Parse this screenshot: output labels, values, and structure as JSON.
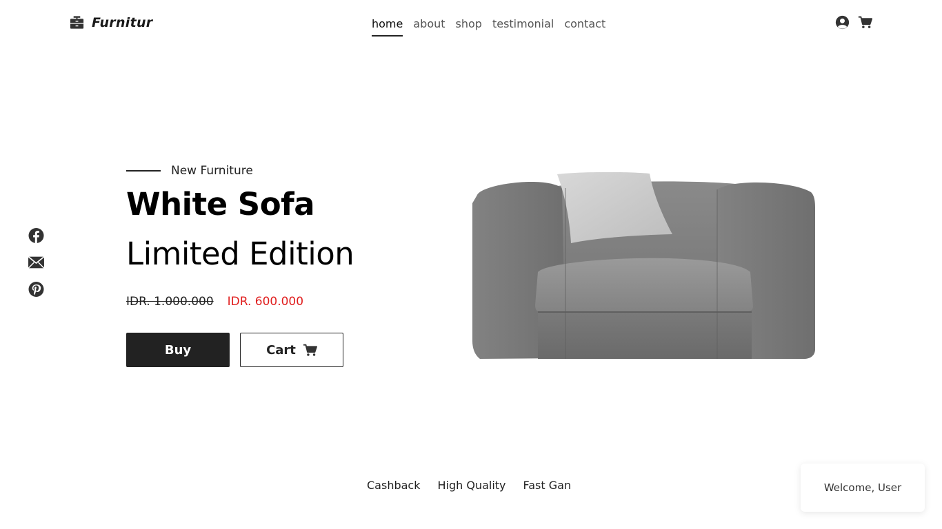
{
  "brand": {
    "name": "Furnitur",
    "icon": "dresser-icon"
  },
  "nav": {
    "items": [
      {
        "label": "home",
        "active": true
      },
      {
        "label": "about",
        "active": false
      },
      {
        "label": "shop",
        "active": false
      },
      {
        "label": "testimonial",
        "active": false
      },
      {
        "label": "contact",
        "active": false
      }
    ]
  },
  "header_icons": [
    "user-circle-icon",
    "cart-icon"
  ],
  "social": [
    "facebook-icon",
    "envelope-icon",
    "pinterest-icon"
  ],
  "hero": {
    "eyebrow": "New Furniture",
    "title_line1": "White Sofa",
    "title_line2": "Limited Edition",
    "price_old": "IDR. 1.000.000",
    "price_new": "IDR. 600.000",
    "buy_label": "Buy",
    "cart_label": "Cart",
    "image": "gray-armchair-sofa"
  },
  "features": [
    "Cashback",
    "High Quality",
    "Fast Gan"
  ],
  "toast": {
    "text": "Welcome, User"
  },
  "colors": {
    "dark": "#222222",
    "accent_price": "#e01e1e",
    "background": "#ffffff"
  }
}
